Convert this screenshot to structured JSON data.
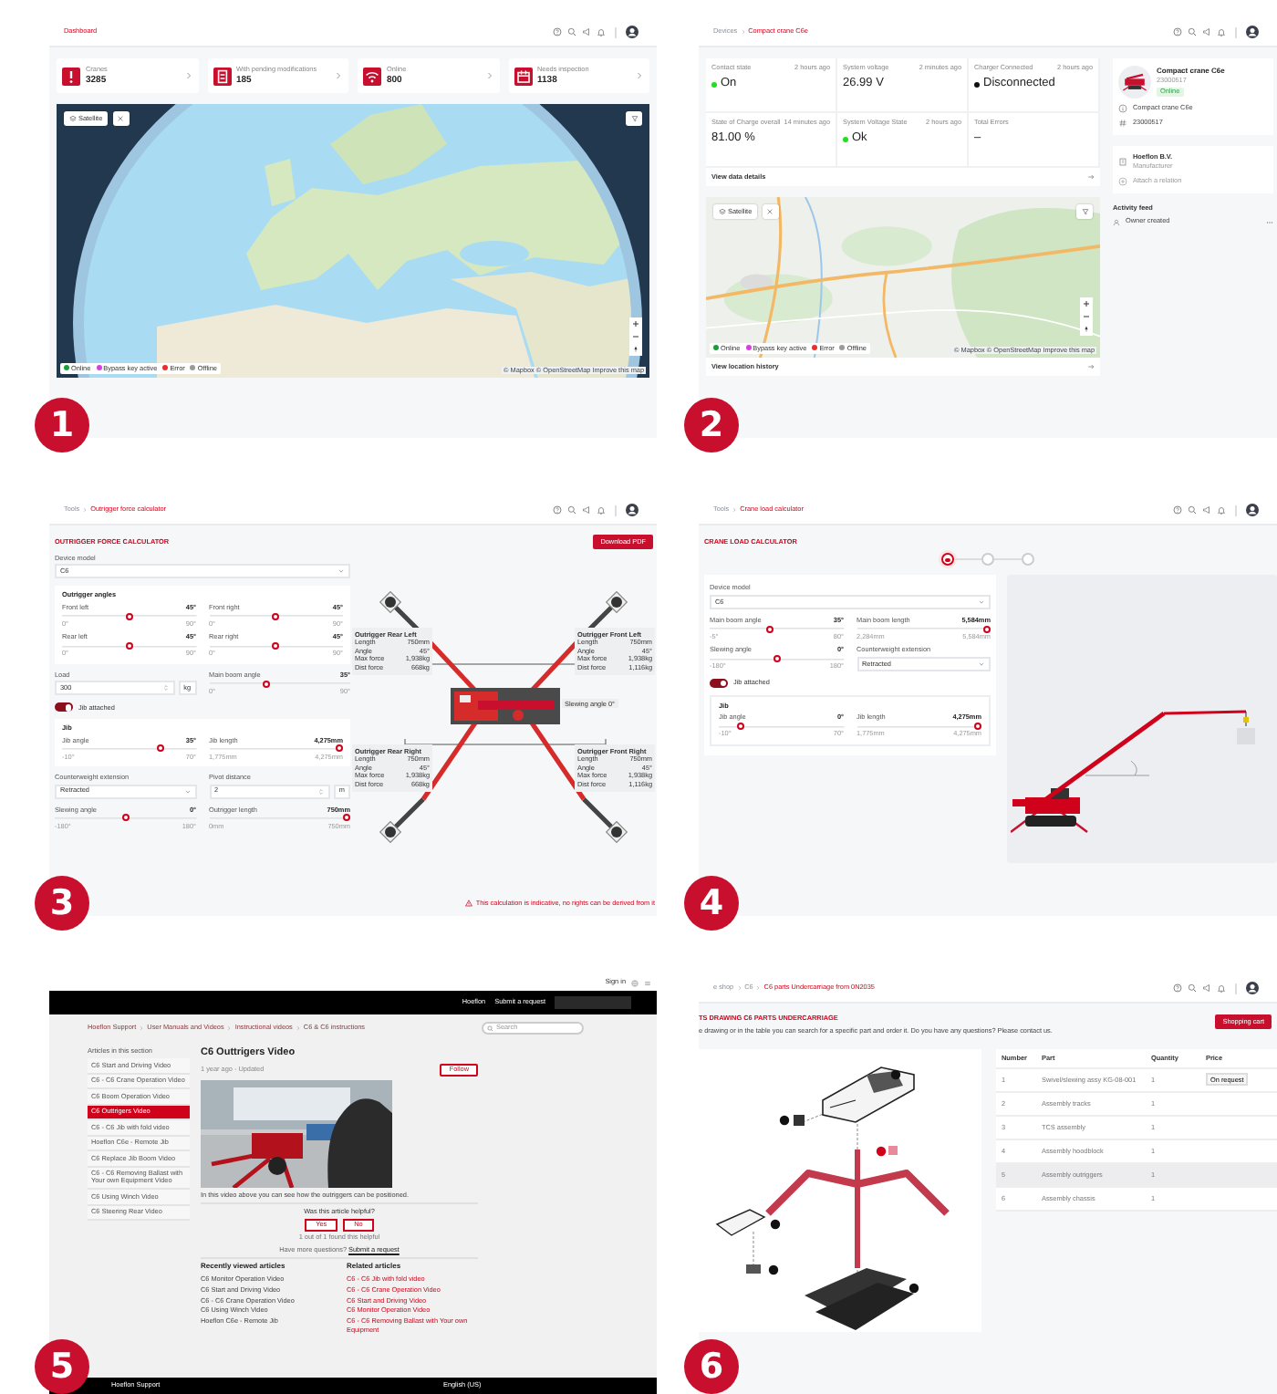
{
  "panels": [
    {
      "kind": "dashboard",
      "number": "1",
      "breadcrumb": [
        {
          "label": "Dashboard",
          "current": true
        }
      ],
      "stats": [
        {
          "label": "Cranes",
          "value": "3285"
        },
        {
          "label": "With pending modifications",
          "value": "185"
        },
        {
          "label": "Online",
          "value": "800"
        },
        {
          "label": "Needs inspection",
          "value": "1138"
        }
      ],
      "map": {
        "satellite": "Satellite",
        "legend": [
          {
            "label": "Online",
            "color": "#1a9e3a"
          },
          {
            "label": "Bypass key active",
            "color": "#d63ee0"
          },
          {
            "label": "Error",
            "color": "#e8302a"
          },
          {
            "label": "Offline",
            "color": "#9a9a9a"
          }
        ],
        "attribution": "© Mapbox © OpenStreetMap Improve this map"
      }
    },
    {
      "kind": "device",
      "number": "2",
      "breadcrumb": [
        {
          "label": "Devices",
          "current": false
        },
        {
          "label": "Compact crane C6e",
          "current": true
        }
      ],
      "readings": [
        {
          "label": "Contact state",
          "time": "2 hours ago",
          "value": "On",
          "color": "#22dd22"
        },
        {
          "label": "System voltage",
          "time": "2 minutes ago",
          "value": "26.99 V"
        },
        {
          "label": "Charger Connected",
          "time": "2 hours ago",
          "value": "Disconnected",
          "color": "#111111"
        },
        {
          "label": "State of Charge overall",
          "time": "14 minutes ago",
          "value": "81.00 %"
        },
        {
          "label": "System Voltage State",
          "time": "2 hours ago",
          "value": "Ok",
          "color": "#22dd22"
        },
        {
          "label": "Total Errors",
          "value": "–"
        }
      ],
      "details_link": "View data details",
      "map": {
        "satellite": "Satellite",
        "legend": [
          {
            "label": "Online",
            "color": "#1a9e3a"
          },
          {
            "label": "Bypass key active",
            "color": "#d63ee0"
          },
          {
            "label": "Error",
            "color": "#e8302a"
          },
          {
            "label": "Offline",
            "color": "#9a9a9a"
          }
        ],
        "attribution": "© Mapbox © OpenStreetMap Improve this map"
      },
      "history_link": "View location history",
      "device": {
        "name": "Compact crane C6e",
        "serial": "23000517",
        "status": "Online",
        "rows": [
          {
            "kind": "model",
            "text": "Compact crane C6e"
          },
          {
            "kind": "serial",
            "text": "23000517"
          }
        ]
      },
      "relations": [
        {
          "name": "Hoeflon B.V.",
          "role": "Manufacturer"
        }
      ],
      "attach": "Attach a relation",
      "activity": {
        "title": "Activity feed",
        "items": [
          "Owner created"
        ]
      }
    },
    {
      "kind": "outrigger",
      "number": "3",
      "breadcrumb": [
        {
          "label": "Tools",
          "current": false
        },
        {
          "label": "Outrigger force calculator",
          "current": true
        }
      ],
      "title": "OUTRIGGER FORCE CALCULATOR",
      "download": "Download PDF",
      "device_model": {
        "label": "Device model",
        "value": "C6"
      },
      "angles": {
        "title": "Outrigger angles",
        "sliders": [
          {
            "label": "Front left",
            "reading": "45°",
            "min": "0°",
            "max": "90°",
            "level": 0.5
          },
          {
            "label": "Front right",
            "reading": "45°",
            "min": "0°",
            "max": "90°",
            "level": 0.5
          },
          {
            "label": "Rear left",
            "reading": "45°",
            "min": "0°",
            "max": "90°",
            "level": 0.5
          },
          {
            "label": "Rear right",
            "reading": "45°",
            "min": "0°",
            "max": "90°",
            "level": 0.5
          }
        ]
      },
      "load": {
        "label": "Load",
        "value": "300",
        "unit": "kg"
      },
      "boom_angle": {
        "label": "Main boom angle",
        "reading": "35°",
        "min": "0°",
        "max": "90°",
        "level": 0.4
      },
      "jib_toggle": {
        "label": "Jib attached",
        "on": true
      },
      "jib": {
        "title": "Jib",
        "sliders": [
          {
            "label": "Jib angle",
            "reading": "35°",
            "min": "-10°",
            "max": "70°",
            "level": 0.75
          },
          {
            "label": "Jib length",
            "reading": "4,275mm",
            "min": "1,775mm",
            "max": "4,275mm",
            "level": 1
          }
        ]
      },
      "counterweight": {
        "label": "Counterweight extension",
        "value": "Retracted"
      },
      "pivot": {
        "label": "Pivot distance",
        "value": "2",
        "unit": "m"
      },
      "bottom_sliders": [
        {
          "label": "Slewing angle",
          "reading": "0°",
          "min": "-180°",
          "max": "180°",
          "level": 0.5
        },
        {
          "label": "Outrigger length",
          "reading": "750mm",
          "min": "0mm",
          "max": "750mm",
          "level": 1
        }
      ],
      "outriggers": [
        {
          "title": "Outrigger Rear Left",
          "specs": [
            {
              "label": "Length",
              "value": "750mm"
            },
            {
              "label": "Angle",
              "value": "45°"
            },
            {
              "label": "Max force",
              "value": "1,938kg"
            },
            {
              "label": "Dist force",
              "value": "668kg"
            }
          ]
        },
        {
          "title": "Outrigger Front Left",
          "specs": [
            {
              "label": "Length",
              "value": "750mm"
            },
            {
              "label": "Angle",
              "value": "45°"
            },
            {
              "label": "Max force",
              "value": "1,938kg"
            },
            {
              "label": "Dist force",
              "value": "1,116kg"
            }
          ]
        },
        {
          "title": "Outrigger Rear Right",
          "specs": [
            {
              "label": "Length",
              "value": "750mm"
            },
            {
              "label": "Angle",
              "value": "45°"
            },
            {
              "label": "Max force",
              "value": "1,938kg"
            },
            {
              "label": "Dist force",
              "value": "668kg"
            }
          ]
        },
        {
          "title": "Outrigger Front Right",
          "specs": [
            {
              "label": "Length",
              "value": "750mm"
            },
            {
              "label": "Angle",
              "value": "45°"
            },
            {
              "label": "Max force",
              "value": "1,938kg"
            },
            {
              "label": "Dist force",
              "value": "1,116kg"
            }
          ]
        }
      ],
      "slewing_label": "Slewing angle 0°",
      "warning": "This calculation is indicative, no rights can be derived from it"
    },
    {
      "kind": "craneload",
      "number": "4",
      "breadcrumb": [
        {
          "label": "Tools",
          "current": false
        },
        {
          "label": "Crane load calculator",
          "current": true
        }
      ],
      "title": "CRANE LOAD CALCULATOR",
      "steps": [
        {
          "selected": true
        },
        {
          "selected": false
        },
        {
          "selected": false
        }
      ],
      "device_model": {
        "label": "Device model",
        "value": "C6"
      },
      "fields": [
        {
          "kind": "slider",
          "label": "Main boom angle",
          "reading": "35°",
          "min": "-5°",
          "max": "80°",
          "level": 0.45
        },
        {
          "kind": "slider",
          "label": "Main boom length",
          "reading": "5,584mm",
          "min": "2,284mm",
          "max": "5,584mm",
          "level": 1
        },
        {
          "kind": "slider",
          "label": "Slewing angle",
          "reading": "0°",
          "min": "-180°",
          "max": "180°",
          "level": 0.5
        },
        {
          "kind": "select",
          "label": "Counterweight extension",
          "value": "Retracted"
        }
      ],
      "jib_toggle": {
        "label": "Jib attached",
        "on": true
      },
      "jib": {
        "title": "Jib",
        "sliders": [
          {
            "label": "Jib angle",
            "reading": "0°",
            "min": "-10°",
            "max": "70°",
            "level": 0.15
          },
          {
            "label": "Jib length",
            "reading": "4,275mm",
            "min": "1,775mm",
            "max": "4,275mm",
            "level": 1
          }
        ]
      }
    },
    {
      "kind": "article",
      "number": "5",
      "sign_in": "Sign in",
      "nav": [
        "Hoeflon",
        "Submit a request"
      ],
      "breadcrumb": [
        {
          "label": "Hoeflon Support"
        },
        {
          "label": "User Manuals and Videos"
        },
        {
          "label": "Instructional videos"
        },
        {
          "label": "C6 & C6 instructions"
        }
      ],
      "search": {
        "placeholder": "Search"
      },
      "section_title": "Articles in this section",
      "articles": [
        {
          "title": "C6 Start and Driving Video",
          "selected": false
        },
        {
          "title": "C6 - C6 Crane Operation Video",
          "selected": false
        },
        {
          "title": "C6 Boom Operation Video",
          "selected": false
        },
        {
          "title": "C6 Outtrigers Video",
          "selected": true
        },
        {
          "title": "C6 - C6 Jib with fold video",
          "selected": false
        },
        {
          "title": "Hoeflon C6e - Remote Jib",
          "selected": false
        },
        {
          "title": "C6 Replace Jib Boom Video",
          "selected": false
        },
        {
          "title": "C6 - C6 Removing Ballast with Your own Equipment Video",
          "selected": false
        },
        {
          "title": "C6 Using Winch Video",
          "selected": false
        },
        {
          "title": "C6 Steering Rear Video",
          "selected": false
        }
      ],
      "title": "C6 Outtrigers Video",
      "meta": "1 year ago · Updated",
      "follow": "Follow",
      "description": "In this video above you can see how the outriggers can be positioned.",
      "helpful": {
        "question": "Was this article helpful?",
        "buttons": [
          "Yes",
          "No"
        ],
        "count": "1 out of 1 found this helpful"
      },
      "more": {
        "text": "Have more questions?",
        "link": "Submit a request"
      },
      "recent": {
        "title": "Recently viewed articles",
        "items": [
          "C6 Monitor Operation Video",
          "C6 Start and Driving Video",
          "C6 - C6 Crane Operation Video",
          "C6 Using Winch Video",
          "Hoeflon C6e - Remote Jib"
        ]
      },
      "related": {
        "title": "Related articles",
        "items": [
          "C6 - C6 Jib with fold video",
          "C6 - C6 Crane Operation Video",
          "C6 Start and Driving Video",
          "C6 Monitor Operation Video",
          "C6 - C6 Removing Ballast with Your own Equipment"
        ]
      },
      "footer": {
        "brand": "Hoeflon Support",
        "language": "English (US)"
      }
    },
    {
      "kind": "parts",
      "number": "6",
      "breadcrumb": [
        {
          "label": "e shop",
          "current": false
        },
        {
          "label": "C6",
          "current": false
        },
        {
          "label": "C6 parts Undercarriage from 0N2035",
          "current": true
        }
      ],
      "title": "TS DRAWING C6 PARTS UNDERCARRIAGE",
      "description": "e drawing or in the table you can search for a specific part and order it. Do you have any questions? Please contact us.",
      "cart": "Shopping cart",
      "columns": [
        "Number",
        "Part",
        "Quantity",
        "Price"
      ],
      "rows": [
        {
          "cells": [
            "1",
            "Swivel/slewing assy KG-08-001",
            "1",
            "On request"
          ],
          "selected": false
        },
        {
          "cells": [
            "2",
            "Assembly tracks",
            "1"
          ],
          "selected": false
        },
        {
          "cells": [
            "3",
            "TCS assembly",
            "1"
          ],
          "selected": false
        },
        {
          "cells": [
            "4",
            "Assembly hoodblock",
            "1"
          ],
          "selected": false
        },
        {
          "cells": [
            "5",
            "Assembly outriggers",
            "1"
          ],
          "selected": true
        },
        {
          "cells": [
            "6",
            "Assembly chassis",
            "1"
          ],
          "selected": false
        }
      ]
    }
  ]
}
